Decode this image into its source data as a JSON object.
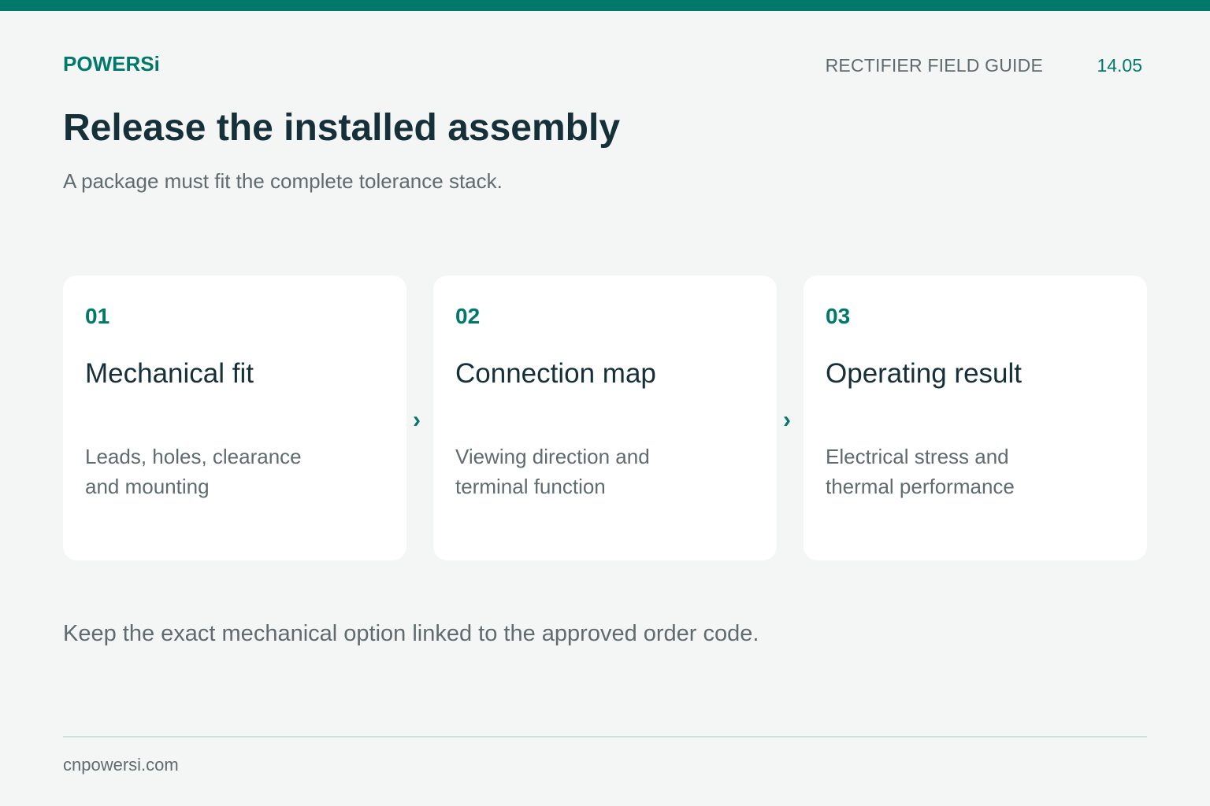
{
  "header": {
    "brand": "POWERSi",
    "guide_label": "RECTIFIER FIELD GUIDE",
    "page_number": "14.05"
  },
  "main": {
    "title": "Release the installed assembly",
    "subtitle": "A package must fit the complete tolerance stack.",
    "steps": [
      {
        "number": "01",
        "title": "Mechanical fit",
        "description_lines": [
          "Leads, holes, clearance",
          "and mounting"
        ]
      },
      {
        "number": "02",
        "title": "Connection map",
        "description_lines": [
          "Viewing direction and",
          "terminal function"
        ]
      },
      {
        "number": "03",
        "title": "Operating result",
        "description_lines": [
          "Electrical stress and",
          "thermal performance"
        ]
      }
    ],
    "step_arrow": "›",
    "note": "Keep the exact mechanical option linked to the approved order code."
  },
  "footer": {
    "url": "cnpowersi.com"
  },
  "colors": {
    "accent": "#00796b",
    "background": "#f4f6f5",
    "card": "#ffffff",
    "heading": "#16303a",
    "body_text": "#5f6b6e",
    "divider": "#cfe0da"
  }
}
